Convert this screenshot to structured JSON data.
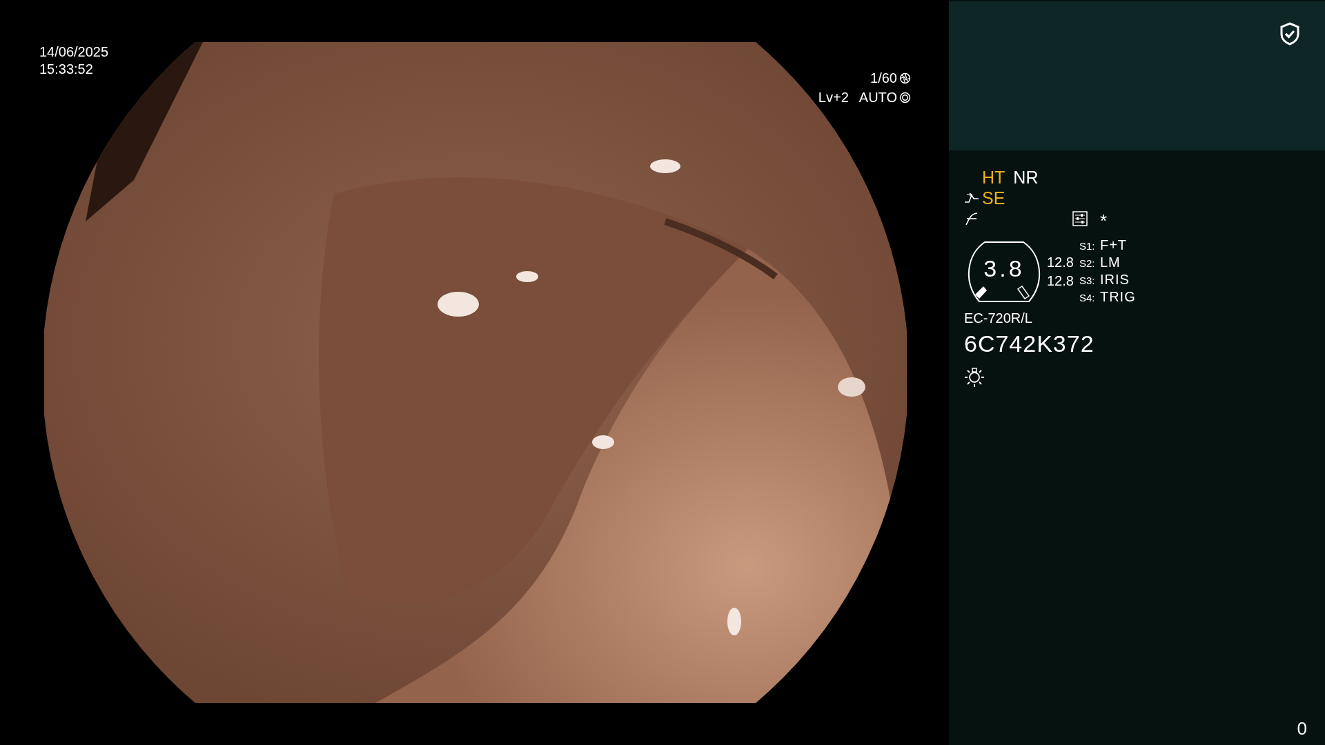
{
  "video": {
    "date": "14/06/2025",
    "time": "15:33:52",
    "shutter": "1/60",
    "level": "Lv+2",
    "iris": "AUTO"
  },
  "panel": {
    "modes": [
      {
        "label": "HT",
        "on": true
      },
      {
        "label": "NR",
        "on": false
      }
    ],
    "enhance": {
      "label": "SE",
      "on": true
    },
    "asterisk": "*",
    "gauge": {
      "value": "3.8"
    },
    "readings": [
      "12.8",
      "12.8"
    ],
    "switches": [
      {
        "key": "S1:",
        "value": "F+T"
      },
      {
        "key": "S2:",
        "value": "LM"
      },
      {
        "key": "S3:",
        "value": "IRIS"
      },
      {
        "key": "S4:",
        "value": "TRIG"
      }
    ],
    "scope_model": "EC-720R/L",
    "serial": "6C742K372"
  },
  "counter": "0"
}
